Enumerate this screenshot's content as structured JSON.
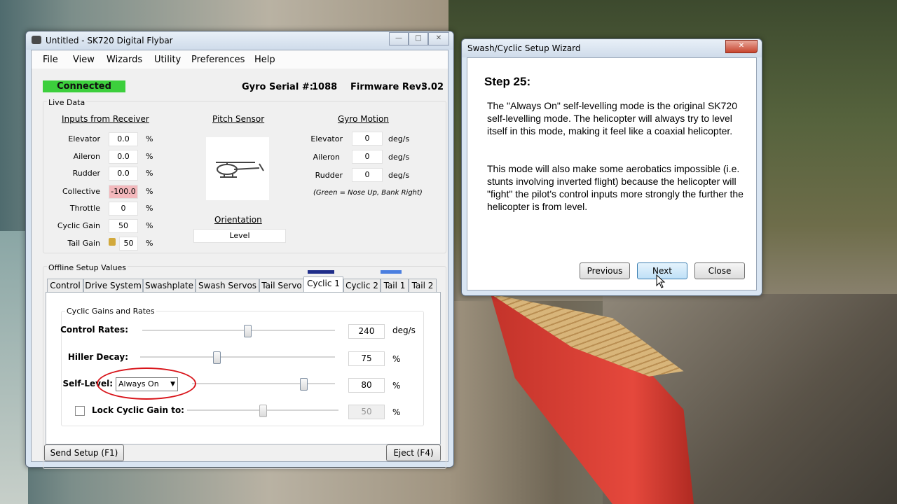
{
  "main_window": {
    "title": "Untitled - SK720 Digital Flybar",
    "menu": [
      "File",
      "View",
      "Wizards",
      "Utility",
      "Preferences",
      "Help"
    ],
    "status": "Connected",
    "serial_label": "Gyro Serial #:",
    "serial_value": "1088",
    "firmware_label": "Firmware Rev:",
    "firmware_value": "3.02",
    "live_data_label": "Live Data",
    "inputs": {
      "title": "Inputs from Receiver",
      "rows": [
        {
          "label": "Elevator",
          "value": "0.0",
          "unit": "%"
        },
        {
          "label": "Aileron",
          "value": "0.0",
          "unit": "%"
        },
        {
          "label": "Rudder",
          "value": "0.0",
          "unit": "%"
        },
        {
          "label": "Collective",
          "value": "-100.0",
          "unit": "%"
        },
        {
          "label": "Throttle",
          "value": "0",
          "unit": "%"
        },
        {
          "label": "Cyclic Gain",
          "value": "50",
          "unit": "%"
        },
        {
          "label": "Tail Gain",
          "value": "50",
          "unit": "%"
        }
      ]
    },
    "pitch_sensor": {
      "title": "Pitch Sensor",
      "orientation_label": "Orientation",
      "orientation_value": "Level"
    },
    "gyro_motion": {
      "title": "Gyro Motion",
      "rows": [
        {
          "label": "Elevator",
          "value": "0",
          "unit": "deg/s"
        },
        {
          "label": "Aileron",
          "value": "0",
          "unit": "deg/s"
        },
        {
          "label": "Rudder",
          "value": "0",
          "unit": "deg/s"
        }
      ],
      "note": "(Green = Nose Up, Bank Right)"
    },
    "offline_label": "Offline Setup Values",
    "tabs": [
      "Control",
      "Drive System",
      "Swashplate",
      "Swash Servos",
      "Tail Servo",
      "Cyclic 1",
      "Cyclic 2",
      "Tail 1",
      "Tail 2"
    ],
    "active_tab": "Cyclic 1",
    "group_label": "Cyclic Gains and Rates",
    "sliders": [
      {
        "label": "Control Rates:",
        "value": "240",
        "unit": "deg/s",
        "level": 0.55
      },
      {
        "label": "Hiller Decay:",
        "value": "75",
        "unit": "%",
        "level": 0.39
      },
      {
        "label": "Self-Level:",
        "value": "80",
        "unit": "%",
        "level": 0.8
      },
      {
        "label": "Lock Cyclic Gain to:",
        "value": "50",
        "unit": "%",
        "level": 0.5
      }
    ],
    "self_level_mode": "Always On",
    "send_button": "Send Setup (F1)",
    "eject_button": "Eject (F4)"
  },
  "wizard": {
    "title": "Swash/Cyclic Setup Wizard",
    "step": "Step 25:",
    "paragraph1": "The \"Always On\" self-levelling mode is the original SK720 self-levelling mode. The helicopter will always try to level itself in this mode, making it feel like a coaxial helicopter.",
    "paragraph2": "This mode will also make some aerobatics impossible (i.e. stunts involving inverted flight) because the helicopter will \"fight\" the pilot's control inputs more strongly the further the helicopter is from level.",
    "previous_button": "Previous",
    "next_button": "Next",
    "close_button": "Close"
  },
  "colors": {
    "connected": "#3ccf3c",
    "collective_bg": "#f3b8bc",
    "accent_blue": "#1f2d8a",
    "accent_light": "#4b7fe0",
    "annotation": "#d8141a"
  }
}
